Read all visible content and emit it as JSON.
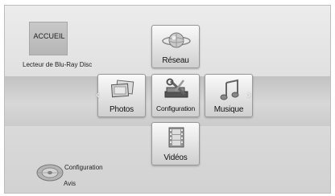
{
  "home": {
    "title": "ACCUEIL",
    "device": "Lecteur de Blu-Ray Disc"
  },
  "menu": {
    "reseau": "Réseau",
    "photos": "Photos",
    "configuration": "Configuration",
    "musique": "Musique",
    "videos": "Vidéos"
  },
  "arrows": {
    "left": "‹",
    "right": "›"
  },
  "options": {
    "configuration": "Configuration",
    "avis": "Avis"
  }
}
